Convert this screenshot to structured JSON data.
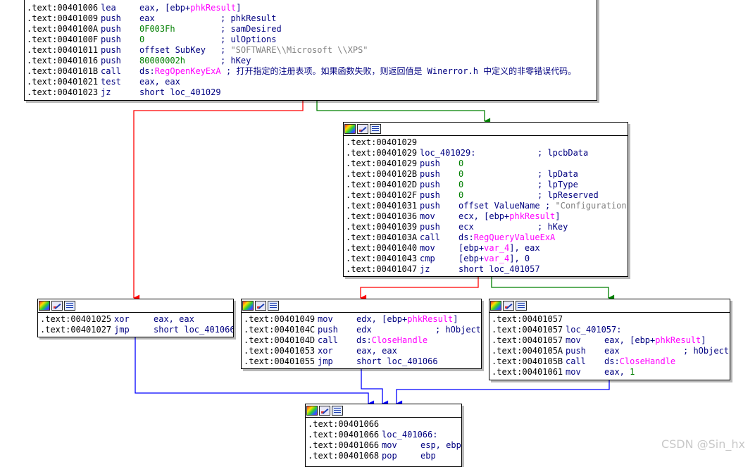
{
  "block_top": {
    "lines": [
      {
        "addr": ".text:00401006",
        "mn": "lea",
        "op": "eax, [ebp+phkResult]",
        "op_hl": "phkResult",
        "cmt": ""
      },
      {
        "addr": ".text:00401009",
        "mn": "push",
        "op": "eax",
        "cmt": "; phkResult"
      },
      {
        "addr": ".text:0040100A",
        "mn": "push",
        "op": "0F003Fh",
        "op_style": "gr",
        "cmt": "; samDesired"
      },
      {
        "addr": ".text:0040100F",
        "mn": "push",
        "op": "0",
        "op_style": "gr",
        "cmt": "; ulOptions"
      },
      {
        "addr": ".text:00401011",
        "mn": "push",
        "op": "offset SubKey",
        "cmt": "; \"SOFTWARE\\\\Microsoft \\\\XPS\"",
        "cmt_style": "str"
      },
      {
        "addr": ".text:00401016",
        "mn": "push",
        "op": "80000002h",
        "op_style": "gr",
        "cmt": "; hKey"
      },
      {
        "addr": ".text:0040101B",
        "mn": "call",
        "op": "ds:RegOpenKeyExA",
        "op_hl": "RegOpenKeyExA",
        "cmt": "; 打开指定的注册表项。如果函数失败，则返回值是 Winerror.h 中定义的非零错误代码。"
      },
      {
        "addr": ".text:00401021",
        "mn": "test",
        "op": "eax, eax",
        "cmt": ""
      },
      {
        "addr": ".text:00401023",
        "mn": "jz",
        "op": "short loc_401029",
        "cmt": ""
      }
    ]
  },
  "block_401029": {
    "lines": [
      {
        "addr": ".text:00401029",
        "mn": "",
        "op": "",
        "cmt": ""
      },
      {
        "addr": ".text:00401029",
        "mn": "loc_401029:",
        "op": "",
        "cmt": "; lpcbData",
        "label": true
      },
      {
        "addr": ".text:00401029",
        "mn": "push",
        "op": "0",
        "op_style": "gr",
        "cmt": ""
      },
      {
        "addr": ".text:0040102B",
        "mn": "push",
        "op": "0",
        "op_style": "gr",
        "cmt": "; lpData"
      },
      {
        "addr": ".text:0040102D",
        "mn": "push",
        "op": "0",
        "op_style": "gr",
        "cmt": "; lpType"
      },
      {
        "addr": ".text:0040102F",
        "mn": "push",
        "op": "0",
        "op_style": "gr",
        "cmt": "; lpReserved"
      },
      {
        "addr": ".text:00401031",
        "mn": "push",
        "op": "offset ValueName",
        "cmt": "; \"Configuration\"",
        "cmt_style": "str"
      },
      {
        "addr": ".text:00401036",
        "mn": "mov",
        "op": "ecx, [ebp+phkResult]",
        "op_hl": "phkResult",
        "cmt": ""
      },
      {
        "addr": ".text:00401039",
        "mn": "push",
        "op": "ecx",
        "cmt": "; hKey"
      },
      {
        "addr": ".text:0040103A",
        "mn": "call",
        "op": "ds:RegQueryValueExA",
        "op_hl": "RegQueryValueExA",
        "cmt": ""
      },
      {
        "addr": ".text:00401040",
        "mn": "mov",
        "op": "[ebp+var_4], eax",
        "op_hl": "var_4",
        "cmt": ""
      },
      {
        "addr": ".text:00401043",
        "mn": "cmp",
        "op": "[ebp+var_4], 0",
        "op_hl": "var_4",
        "cmt": ""
      },
      {
        "addr": ".text:00401047",
        "mn": "jz",
        "op": "short loc_401057",
        "cmt": ""
      }
    ]
  },
  "block_401025": {
    "lines": [
      {
        "addr": ".text:00401025",
        "mn": "xor",
        "op": "eax, eax",
        "cmt": ""
      },
      {
        "addr": ".text:00401027",
        "mn": "jmp",
        "op": "short loc_401066",
        "cmt": ""
      }
    ]
  },
  "block_401049": {
    "lines": [
      {
        "addr": ".text:00401049",
        "mn": "mov",
        "op": "edx, [ebp+phkResult]",
        "op_hl": "phkResult",
        "cmt": ""
      },
      {
        "addr": ".text:0040104C",
        "mn": "push",
        "op": "edx",
        "cmt": "; hObject"
      },
      {
        "addr": ".text:0040104D",
        "mn": "call",
        "op": "ds:CloseHandle",
        "op_hl": "CloseHandle",
        "cmt": ""
      },
      {
        "addr": ".text:00401053",
        "mn": "xor",
        "op": "eax, eax",
        "cmt": ""
      },
      {
        "addr": ".text:00401055",
        "mn": "jmp",
        "op": "short loc_401066",
        "cmt": ""
      }
    ]
  },
  "block_401057": {
    "lines": [
      {
        "addr": ".text:00401057",
        "mn": "",
        "op": "",
        "cmt": ""
      },
      {
        "addr": ".text:00401057",
        "mn": "loc_401057:",
        "op": "",
        "cmt": "",
        "label": true
      },
      {
        "addr": ".text:00401057",
        "mn": "mov",
        "op": "eax, [ebp+phkResult]",
        "op_hl": "phkResult",
        "cmt": ""
      },
      {
        "addr": ".text:0040105A",
        "mn": "push",
        "op": "eax",
        "cmt": "; hObject"
      },
      {
        "addr": ".text:0040105B",
        "mn": "call",
        "op": "ds:CloseHandle",
        "op_hl": "CloseHandle",
        "cmt": ""
      },
      {
        "addr": ".text:00401061",
        "mn": "mov",
        "op": "eax, 1",
        "op_tail_gr": "1",
        "cmt": ""
      }
    ]
  },
  "block_401066": {
    "lines": [
      {
        "addr": ".text:00401066",
        "mn": "",
        "op": "",
        "cmt": ""
      },
      {
        "addr": ".text:00401066",
        "mn": "loc_401066:",
        "op": "",
        "cmt": "",
        "label": true
      },
      {
        "addr": ".text:00401066",
        "mn": "mov",
        "op": "esp, ebp",
        "cmt": ""
      },
      {
        "addr": ".text:00401068",
        "mn": "pop",
        "op": "ebp",
        "cmt": ""
      }
    ]
  },
  "edge_colors": {
    "false_branch": "#ff0000",
    "true_branch": "#008000",
    "unconditional": "#0000ff"
  },
  "watermark": "CSDN @Sin_hx"
}
